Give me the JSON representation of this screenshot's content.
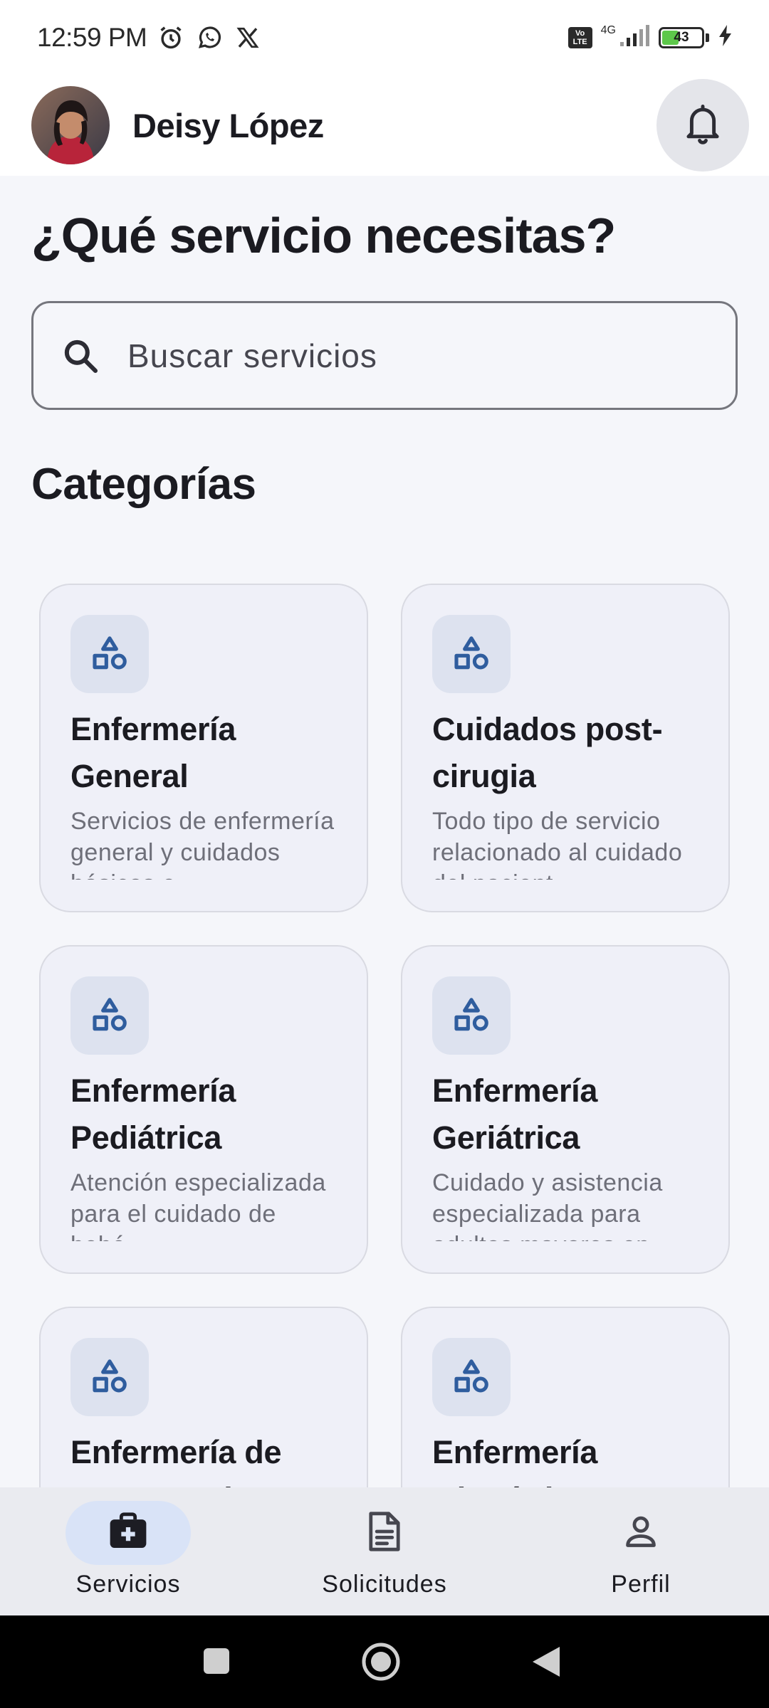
{
  "status_bar": {
    "time": "12:59 PM",
    "network": "4G",
    "volte_top": "Vo",
    "volte_bottom": "LTE",
    "battery_level": "43",
    "icons": [
      "alarm-icon",
      "whatsapp-icon",
      "x-icon",
      "volte-icon",
      "signal-icon",
      "battery-icon",
      "charging-icon"
    ]
  },
  "header": {
    "user_name": "Deisy López",
    "avatar_icon": "profile-photo",
    "notification_icon": "bell-icon"
  },
  "main": {
    "title": "¿Qué servicio necesitas?",
    "search": {
      "placeholder": "Buscar servicios",
      "value": ""
    },
    "section_title": "Categorías",
    "categories": [
      {
        "title": "Enfermería General",
        "description": "Servicios de enfermería general y cuidados básicos e",
        "icon": "shapes-icon"
      },
      {
        "title": "Cuidados post-cirugia",
        "description": "Todo tipo de servicio relacionado al cuidado del pacient",
        "icon": "shapes-icon"
      },
      {
        "title": "Enfermería Pediátrica",
        "description": "Atención especializada para el cuidado de bebé",
        "icon": "shapes-icon"
      },
      {
        "title": "Enfermería Geriátrica",
        "description": "Cuidado y asistencia especializada para adultos mayores en",
        "icon": "shapes-icon"
      },
      {
        "title": "Enfermería de Emergencia",
        "description": "",
        "icon": "shapes-icon"
      },
      {
        "title": "Enfermería Obstétrica",
        "description": "",
        "icon": "shapes-icon"
      }
    ]
  },
  "bottom_nav": {
    "items": [
      {
        "label": "Servicios",
        "icon": "medical-bag-icon",
        "active": true
      },
      {
        "label": "Solicitudes",
        "icon": "document-icon",
        "active": false
      },
      {
        "label": "Perfil",
        "icon": "person-icon",
        "active": false
      }
    ]
  },
  "colors": {
    "accent": "#2f5d9e",
    "active_pill": "#d9e3f7",
    "card_bg": "#eff0f8",
    "battery": "#5dc84a"
  }
}
